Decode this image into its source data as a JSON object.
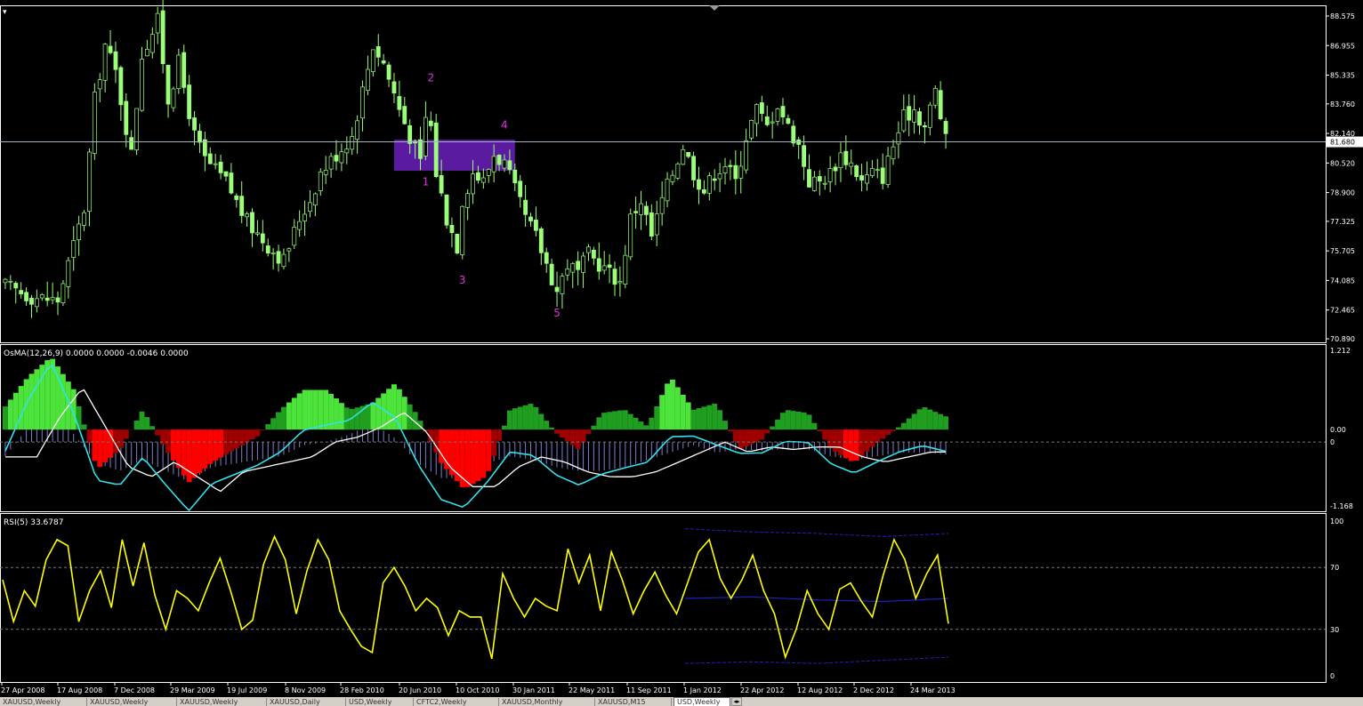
{
  "colors": {
    "background": "#000000",
    "candles": "#9bff7a",
    "grid_frame": "#ffffff",
    "axis_text": "#ffffff",
    "price_line": "#a7b6c3",
    "box": "#5b1ba0",
    "wave_labels": "#e02ee0",
    "osma_pos_strong": "#4ce33a",
    "osma_pos_weak": "#1f9e1f",
    "osma_neg_strong": "#ff0000",
    "osma_neg_weak": "#a00000",
    "macd_hist": "#7e7ed0",
    "macd_fast": "#33e0ee",
    "macd_slow": "#ffffff",
    "rsi_line": "#ffff00",
    "rsi_bands": "#2020c0",
    "level_dash": "#777777"
  },
  "main_pane": {
    "price_axis_labels": [
      "88.575",
      "86.955",
      "85.335",
      "83.760",
      "82.140",
      "80.520",
      "78.900",
      "77.325",
      "75.705",
      "74.085",
      "72.465",
      "70.890"
    ],
    "current_price": "81.680",
    "wave_labels": [
      "1",
      "2",
      "3",
      "4",
      "5"
    ],
    "scroll_marker": "▾"
  },
  "osma_pane": {
    "header": "OsMA(12,26,9) 0.0000 0.0000 -0.0046 0.0000",
    "axis_labels": [
      "1.212",
      "0.00",
      "0",
      "-1.168"
    ]
  },
  "rsi_pane": {
    "header": "RSI(5) 33.6787",
    "axis_labels": [
      "100",
      "70",
      "30",
      "0"
    ]
  },
  "time_axis_labels": [
    "27 Apr 2008",
    "17 Aug 2008",
    "7 Dec 2008",
    "29 Mar 2009",
    "19 Jul 2009",
    "8 Nov 2009",
    "28 Feb 2010",
    "20 Jun 2010",
    "10 Oct 2010",
    "30 Jan 2011",
    "22 May 2011",
    "11 Sep 2011",
    "1 Jan 2012",
    "22 Apr 2012",
    "12 Aug 2012",
    "2 Dec 2012",
    "24 Mar 2013"
  ],
  "tabs": [
    "XAUUSD,Weekly",
    "XAUUSD,Weekly",
    "XAUUSD,Weekly",
    "XAUUSD,Daily",
    "USD,Weekly",
    "CFTC2,Weekly",
    "XAUUSD,Monthly",
    "XAUUSD,M15",
    "USD,Weekly"
  ],
  "chart_data": [
    {
      "type": "candlestick",
      "title": "",
      "ylim": [
        70.89,
        88.575
      ],
      "current_price": 81.68,
      "close_path": [
        [
          0,
          73.8
        ],
        [
          5,
          73.2
        ],
        [
          10,
          73.0
        ],
        [
          12,
          75.0
        ],
        [
          15,
          78.0
        ],
        [
          17,
          84.0
        ],
        [
          19,
          87.0
        ],
        [
          21,
          85.5
        ],
        [
          22,
          84.0
        ],
        [
          24,
          81.0
        ],
        [
          26,
          86.5
        ],
        [
          29,
          88.3
        ],
        [
          31,
          84.0
        ],
        [
          33,
          86.0
        ],
        [
          36,
          82.0
        ],
        [
          38,
          80.7
        ],
        [
          42,
          79.5
        ],
        [
          46,
          77.3
        ],
        [
          50,
          76.0
        ],
        [
          53,
          75.2
        ],
        [
          56,
          77.5
        ],
        [
          58,
          78.5
        ],
        [
          60,
          80.0
        ],
        [
          63,
          81.0
        ],
        [
          66,
          82.0
        ],
        [
          68,
          84.5
        ],
        [
          70,
          87.0
        ],
        [
          72,
          86.0
        ],
        [
          75,
          83.5
        ],
        [
          77,
          82.0
        ],
        [
          79,
          80.5
        ],
        [
          80,
          83.0
        ],
        [
          81,
          82.5
        ],
        [
          82,
          80.0
        ],
        [
          84,
          77.5
        ],
        [
          86,
          76.0
        ],
        [
          87,
          78.5
        ],
        [
          89,
          80.0
        ],
        [
          91,
          79.5
        ],
        [
          93,
          81.0
        ],
        [
          95,
          80.5
        ],
        [
          97,
          79.0
        ],
        [
          99,
          77.5
        ],
        [
          101,
          76.5
        ],
        [
          103,
          75.0
        ],
        [
          105,
          73.5
        ],
        [
          107,
          75.0
        ],
        [
          109,
          74.5
        ],
        [
          111,
          75.5
        ],
        [
          113,
          75.0
        ],
        [
          115,
          74.5
        ],
        [
          117,
          74.0
        ],
        [
          119,
          77.5
        ],
        [
          121,
          78.5
        ],
        [
          123,
          76.5
        ],
        [
          125,
          78.5
        ],
        [
          127,
          80.0
        ],
        [
          129,
          81.5
        ],
        [
          131,
          80.0
        ],
        [
          133,
          79.0
        ],
        [
          135,
          80.0
        ],
        [
          137,
          80.5
        ],
        [
          139,
          79.5
        ],
        [
          141,
          82.0
        ],
        [
          143,
          83.5
        ],
        [
          145,
          82.5
        ],
        [
          147,
          83.8
        ],
        [
          149,
          82.5
        ],
        [
          151,
          81.5
        ],
        [
          153,
          79.5
        ],
        [
          155,
          79.5
        ],
        [
          157,
          80.0
        ],
        [
          159,
          81.0
        ],
        [
          161,
          80.5
        ],
        [
          163,
          79.5
        ],
        [
          165,
          80.0
        ],
        [
          167,
          79.8
        ],
        [
          169,
          81.5
        ],
        [
          171,
          83.0
        ],
        [
          173,
          83.5
        ],
        [
          175,
          82.5
        ],
        [
          177,
          84.5
        ],
        [
          179,
          81.7
        ]
      ],
      "wave_points": [
        {
          "label": "1",
          "x": 80,
          "y": 79.3
        },
        {
          "label": "2",
          "x": 81,
          "y": 85.0
        },
        {
          "label": "3",
          "x": 87,
          "y": 73.9
        },
        {
          "label": "4",
          "x": 95,
          "y": 82.4
        },
        {
          "label": "5",
          "x": 105,
          "y": 72.1
        }
      ],
      "zone": {
        "x_start": 74,
        "x_end": 97,
        "y_low": 80.1,
        "y_high": 81.8
      }
    },
    {
      "type": "bar",
      "title": "OsMA(12,26,9)",
      "ylim": [
        -1.168,
        1.212
      ],
      "series": [
        {
          "name": "OsMA",
          "values": [
            0.35,
            0.8,
            1.1,
            0.6,
            -0.6,
            -0.3,
            0.3,
            -0.3,
            -0.8,
            -0.5,
            -0.3,
            -0.1,
            0.3,
            0.6,
            0.6,
            0.3,
            0.4,
            0.7,
            0.2,
            -0.5,
            -0.9,
            -0.7,
            0.3,
            0.4,
            -0.05,
            -0.3,
            0.25,
            0.3,
            0.05,
            0.8,
            0.3,
            0.4,
            -0.3,
            -0.15,
            0.3,
            0.25,
            -0.3,
            -0.5,
            -0.2,
            0.05,
            0.35,
            0.2
          ]
        },
        {
          "name": "MACD",
          "values": [
            -0.3,
            0.5,
            1.1,
            0.3,
            -0.5,
            -0.7,
            -0.4,
            -0.7,
            -1.0,
            -0.6,
            -0.5,
            -0.4,
            -0.3,
            0.0,
            0.1,
            0.3,
            0.6,
            0.2,
            -0.5,
            -0.9,
            -0.9,
            -0.5,
            -0.3,
            -0.4,
            -0.6,
            -0.7,
            -0.7,
            -0.6,
            -0.4,
            -0.2,
            0.0,
            -0.2,
            -0.1,
            -0.15,
            -0.1,
            -0.1,
            -0.3,
            -0.4,
            -0.3,
            -0.2,
            -0.2,
            -0.25
          ]
        }
      ]
    },
    {
      "type": "line",
      "title": "RSI(5)",
      "ylim": [
        0,
        100
      ],
      "levels": [
        30,
        70
      ],
      "series": [
        {
          "name": "RSI(5)",
          "values": [
            62,
            35,
            55,
            45,
            75,
            88,
            84,
            35,
            55,
            68,
            44,
            88,
            58,
            86,
            52,
            30,
            55,
            50,
            42,
            60,
            76,
            54,
            30,
            36,
            72,
            90,
            75,
            40,
            68,
            88,
            75,
            42,
            30,
            19,
            15,
            60,
            70,
            58,
            42,
            50,
            44,
            26,
            42,
            38,
            38,
            11,
            66,
            50,
            38,
            50,
            45,
            42,
            82,
            60,
            78,
            42,
            80,
            62,
            40,
            55,
            67,
            52,
            40,
            60,
            80,
            88,
            63,
            50,
            62,
            78,
            55,
            40,
            12,
            30,
            55,
            40,
            30,
            56,
            60,
            48,
            38,
            65,
            88,
            75,
            50,
            66,
            78,
            33.7
          ]
        },
        {
          "name": "Upper band",
          "values": [
            95,
            93,
            92,
            90,
            92
          ]
        },
        {
          "name": "Middle band",
          "values": [
            50,
            51,
            49,
            48,
            50
          ]
        },
        {
          "name": "Lower band",
          "values": [
            8,
            9,
            8,
            10,
            12
          ]
        }
      ]
    }
  ]
}
